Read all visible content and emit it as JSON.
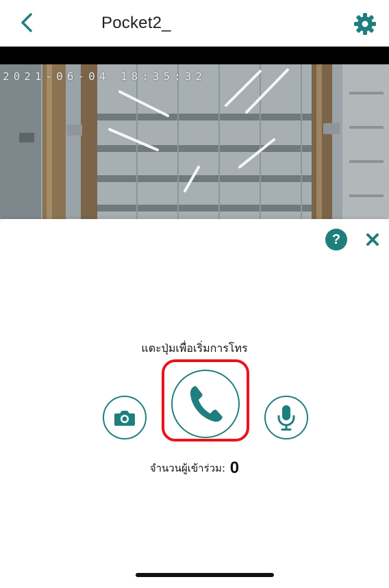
{
  "header": {
    "title": "Pocket2_",
    "back_icon": "chevron-left-icon",
    "settings_icon": "gear-icon"
  },
  "video": {
    "timestamp": "2021-06-04 18:35:32"
  },
  "panel": {
    "help_label": "?",
    "close_icon": "close-icon",
    "instruction": "แตะปุ่มเพื่อเริ่มการโทร",
    "participants_label": "จำนวนผู้เข้าร่วม:",
    "participants_count": "0"
  },
  "colors": {
    "accent": "#1f7e7e",
    "highlight": "#e8141d"
  }
}
